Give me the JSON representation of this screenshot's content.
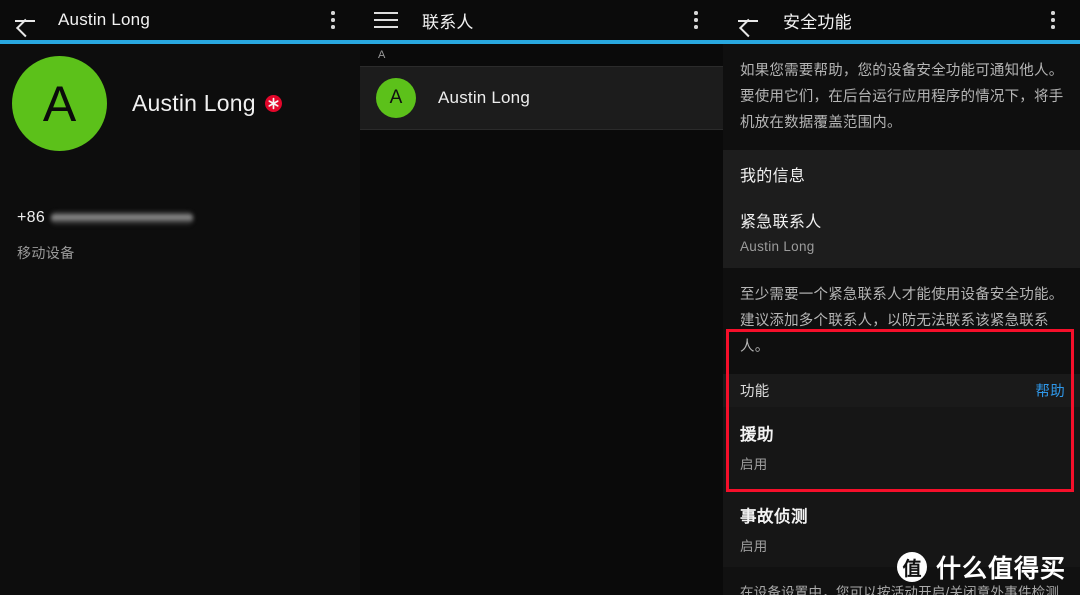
{
  "theme": {
    "accent_rule": "#29a8e0",
    "avatar_green": "#5cc11a",
    "link_blue": "#2f97e8",
    "highlight_red": "#f50f2a",
    "emergency_badge_red": "#e3062a"
  },
  "panel_contact": {
    "appbar": {
      "back_icon": "back-arrow-icon",
      "title": "Austin Long",
      "overflow_icon": "overflow-menu-icon"
    },
    "avatar_letter": "A",
    "name": "Austin Long",
    "emergency_badge": "emergency-asterisk-icon",
    "phone_country_code": "+86",
    "phone_number_redacted": "",
    "phone_type": "移动设备"
  },
  "panel_contacts": {
    "appbar": {
      "menu_icon": "hamburger-menu-icon",
      "title": "联系人",
      "overflow_icon": "overflow-menu-icon"
    },
    "section_index": "A",
    "rows": [
      {
        "avatar_letter": "A",
        "name": "Austin Long"
      }
    ]
  },
  "panel_safety": {
    "appbar": {
      "back_icon": "back-arrow-icon",
      "title": "安全功能",
      "overflow_icon": "overflow-menu-icon"
    },
    "intro_text": "如果您需要帮助，您的设备安全功能可通知他人。要使用它们，在后台运行应用程序的情况下，将手机放在数据覆盖范围内。",
    "my_info_label": "我的信息",
    "emergency_contact_label": "紧急联系人",
    "emergency_contact_value": "Austin Long",
    "emergency_note": "至少需要一个紧急联系人才能使用设备安全功能。建议添加多个联系人，以防无法联系该紧急联系人。",
    "features": {
      "header_label": "功能",
      "help_link": "帮助",
      "items": [
        {
          "title": "援助",
          "status": "启用"
        },
        {
          "title": "事故侦测",
          "status": "启用"
        }
      ]
    },
    "footer_note": "在设备设置中，您可以按活动开启/关闭意外事件检测"
  },
  "watermark": {
    "logo_char": "值",
    "text": "什么值得买"
  }
}
